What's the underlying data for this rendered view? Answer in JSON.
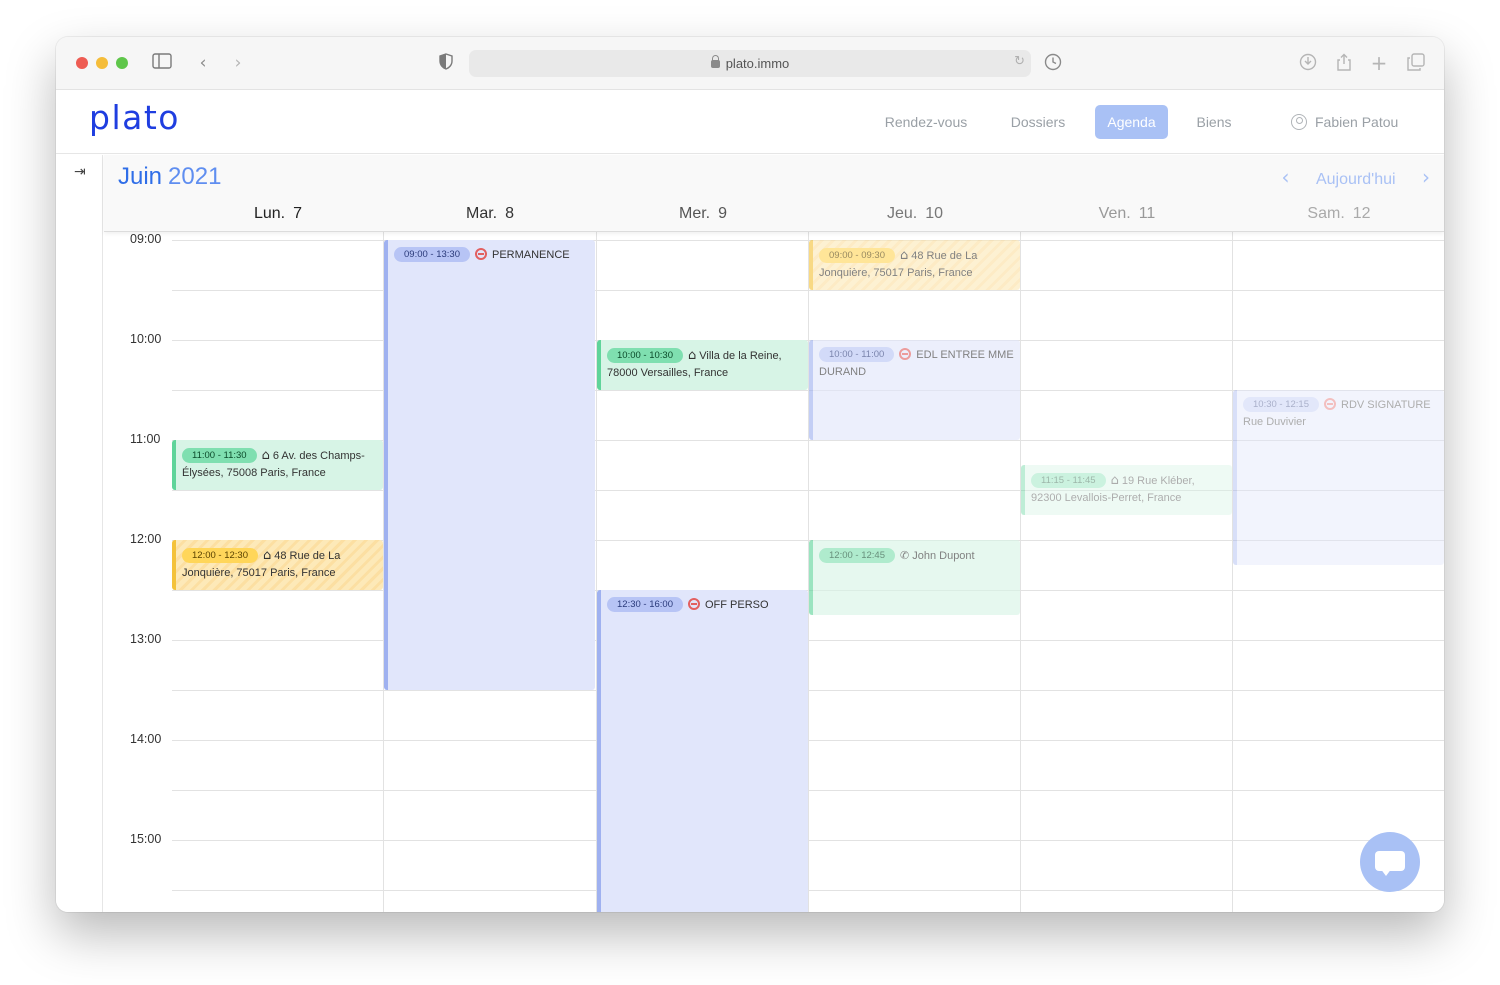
{
  "browser": {
    "url": "plato.immo"
  },
  "header": {
    "logo": "plato",
    "nav": [
      {
        "label": "Rendez-vous",
        "active": false
      },
      {
        "label": "Dossiers",
        "active": false
      },
      {
        "label": "Agenda",
        "active": true
      },
      {
        "label": "Biens",
        "active": false
      }
    ],
    "user": "Fabien Patou"
  },
  "calendar": {
    "month": "Juin",
    "year": "2021",
    "today_label": "Aujourd'hui",
    "days": [
      {
        "name": "Lun.",
        "num": "7",
        "color": "#222222"
      },
      {
        "name": "Mar.",
        "num": "8",
        "color": "#333333"
      },
      {
        "name": "Mer.",
        "num": "9",
        "color": "#555555"
      },
      {
        "name": "Jeu.",
        "num": "10",
        "color": "#777777"
      },
      {
        "name": "Ven.",
        "num": "11",
        "color": "#999999"
      },
      {
        "name": "Sam.",
        "num": "12",
        "color": "#aaaaaa"
      }
    ],
    "hours": [
      "09:00",
      "10:00",
      "11:00",
      "12:00",
      "13:00",
      "14:00",
      "15:00"
    ],
    "events": [
      {
        "day": 0,
        "start": "11:00",
        "end": "11:30",
        "time": "11:00 - 11:30",
        "kind": "home",
        "title": "6 Av. des Champs-Élysées, 75008 Paris, France",
        "color": "green",
        "fade": ""
      },
      {
        "day": 0,
        "start": "12:00",
        "end": "12:30",
        "time": "12:00 - 12:30",
        "kind": "home",
        "title": "48 Rue de La Jonquière, 75017 Paris, France",
        "color": "yellow",
        "fade": ""
      },
      {
        "day": 1,
        "start": "09:00",
        "end": "13:30",
        "time": "09:00 - 13:30",
        "kind": "stop",
        "title": "PERMANENCE",
        "color": "blue",
        "fade": ""
      },
      {
        "day": 2,
        "start": "10:00",
        "end": "10:30",
        "time": "10:00 - 10:30",
        "kind": "home",
        "title": "Villa de la Reine, 78000 Versailles, France",
        "color": "green",
        "fade": ""
      },
      {
        "day": 2,
        "start": "12:30",
        "end": "16:00",
        "time": "12:30 - 16:00",
        "kind": "stop",
        "title": "OFF PERSO",
        "color": "blue",
        "fade": ""
      },
      {
        "day": 3,
        "start": "09:00",
        "end": "09:30",
        "time": "09:00 - 09:30",
        "kind": "home",
        "title": "48 Rue de La Jonquière, 75017 Paris, France",
        "color": "yellow",
        "fade": "faded"
      },
      {
        "day": 3,
        "start": "10:00",
        "end": "11:00",
        "time": "10:00 - 11:00",
        "kind": "stop",
        "title": "EDL ENTREE MME DURAND",
        "color": "blue",
        "fade": "faded"
      },
      {
        "day": 3,
        "start": "12:00",
        "end": "12:45",
        "time": "12:00 - 12:45",
        "kind": "phone",
        "title": "John Dupont",
        "color": "green",
        "fade": "faded"
      },
      {
        "day": 4,
        "start": "11:15",
        "end": "11:45",
        "time": "11:15 - 11:45",
        "kind": "home",
        "title": "19 Rue Kléber, 92300 Levallois-Perret, France",
        "color": "green",
        "fade": "faded2"
      },
      {
        "day": 5,
        "start": "10:30",
        "end": "12:15",
        "time": "10:30 - 12:15",
        "kind": "stop",
        "title": "RDV SIGNATURE Rue Duvivier",
        "color": "blue",
        "fade": "faded2"
      }
    ]
  },
  "icons": {
    "exit": "logout-icon",
    "chat": "chat-icon",
    "home": "house-icon",
    "phone": "phone-icon",
    "stop": "no-entry-icon"
  }
}
